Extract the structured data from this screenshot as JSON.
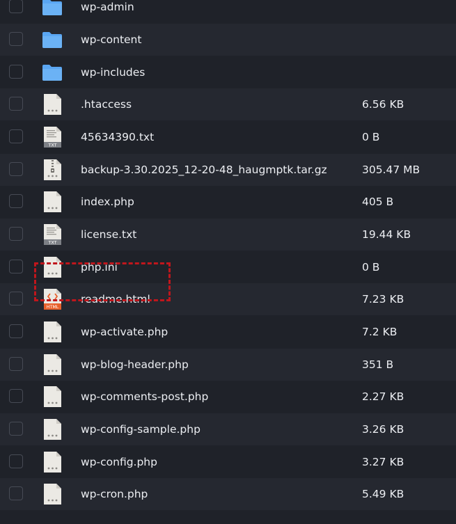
{
  "files": [
    {
      "type": "folder",
      "icon": "folder-icon",
      "name": "wp-admin",
      "size": ""
    },
    {
      "type": "folder",
      "icon": "folder-icon",
      "name": "wp-content",
      "size": ""
    },
    {
      "type": "folder",
      "icon": "folder-icon",
      "name": "wp-includes",
      "size": ""
    },
    {
      "type": "file",
      "icon": "generic-file-icon",
      "name": ".htaccess",
      "size": "6.56 KB"
    },
    {
      "type": "txt",
      "icon": "txt-file-icon",
      "name": "45634390.txt",
      "size": "0 B"
    },
    {
      "type": "archive",
      "icon": "archive-file-icon",
      "name": "backup-3.30.2025_12-20-48_haugmptk.tar.gz",
      "size": "305.47 MB"
    },
    {
      "type": "file",
      "icon": "generic-file-icon",
      "name": "index.php",
      "size": "405 B"
    },
    {
      "type": "txt",
      "icon": "txt-file-icon",
      "name": "license.txt",
      "size": "19.44 KB"
    },
    {
      "type": "file",
      "icon": "generic-file-icon",
      "name": "php.ini",
      "size": "0 B",
      "highlighted": true
    },
    {
      "type": "html",
      "icon": "html-file-icon",
      "name": "readme.html",
      "size": "7.23 KB"
    },
    {
      "type": "file",
      "icon": "generic-file-icon",
      "name": "wp-activate.php",
      "size": "7.2 KB"
    },
    {
      "type": "file",
      "icon": "generic-file-icon",
      "name": "wp-blog-header.php",
      "size": "351 B"
    },
    {
      "type": "file",
      "icon": "generic-file-icon",
      "name": "wp-comments-post.php",
      "size": "2.27 KB"
    },
    {
      "type": "file",
      "icon": "generic-file-icon",
      "name": "wp-config-sample.php",
      "size": "3.26 KB"
    },
    {
      "type": "file",
      "icon": "generic-file-icon",
      "name": "wp-config.php",
      "size": "3.27 KB"
    },
    {
      "type": "file",
      "icon": "generic-file-icon",
      "name": "wp-cron.php",
      "size": "5.49 KB"
    }
  ],
  "badges": {
    "txt": "TXT",
    "html": "HTML"
  },
  "colors": {
    "background": "#1f2229",
    "row_alt": "#252830",
    "folder": "#5aa6f2",
    "file_page": "#ebe9e4",
    "html_badge": "#e8612c",
    "highlight": "#c0161c"
  }
}
